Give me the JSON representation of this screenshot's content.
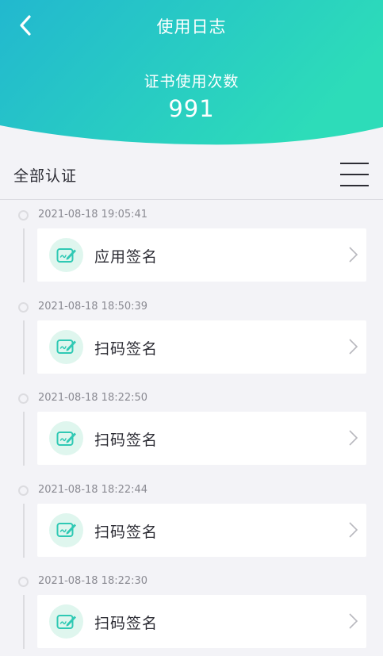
{
  "header": {
    "title": "使用日志",
    "count_label": "证书使用次数",
    "count_value": "991",
    "gradient_start": "#22b8cf",
    "gradient_end": "#2ddcb9"
  },
  "filter": {
    "label": "全部认证"
  },
  "entries": [
    {
      "timestamp": "2021-08-18 19:05:41",
      "label": "应用签名"
    },
    {
      "timestamp": "2021-08-18 18:50:39",
      "label": "扫码签名"
    },
    {
      "timestamp": "2021-08-18 18:22:50",
      "label": "扫码签名"
    },
    {
      "timestamp": "2021-08-18 18:22:44",
      "label": "扫码签名"
    },
    {
      "timestamp": "2021-08-18 18:22:30",
      "label": "扫码签名"
    }
  ],
  "icons": {
    "back": "chevron-left-icon",
    "menu": "menu-icon",
    "entry": "signature-icon",
    "row_arrow": "chevron-right-icon"
  },
  "colors": {
    "accent": "#2fc9b4",
    "icon_bg": "#dff6ee"
  }
}
